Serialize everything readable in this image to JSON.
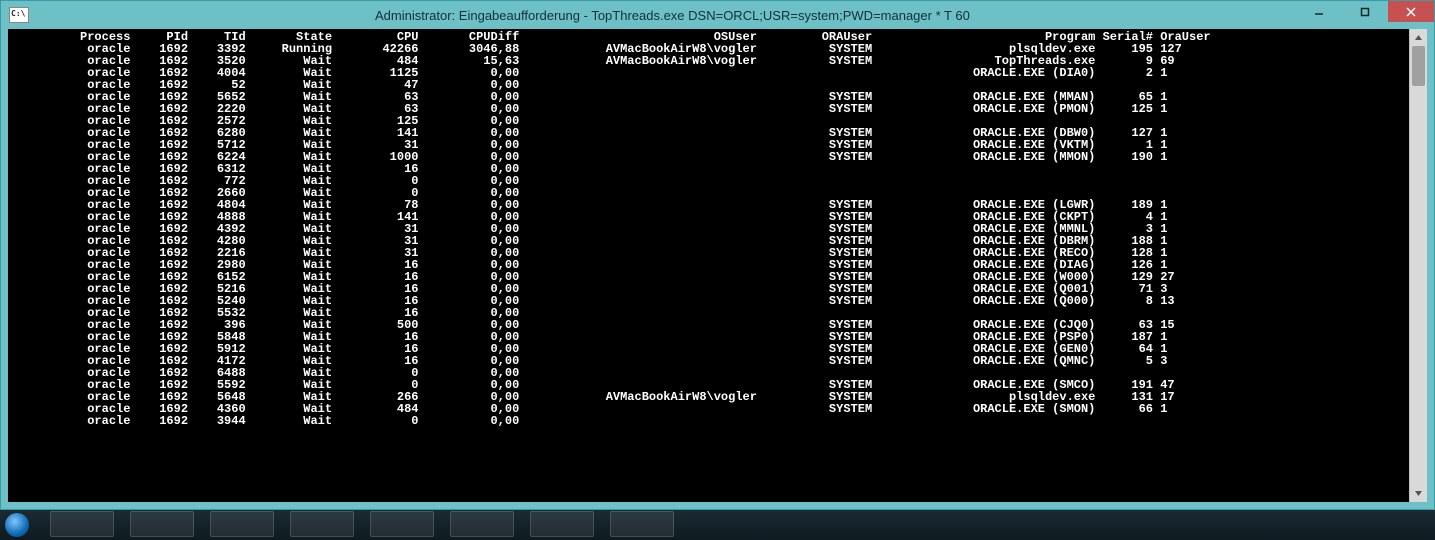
{
  "window": {
    "title": "Administrator: Eingabeaufforderung - TopThreads.exe  DSN=ORCL;USR=system;PWD=manager * T 60"
  },
  "columns": [
    "Process",
    "PId",
    "TId",
    "State",
    "CPU",
    "CPUDiff",
    "OSUser",
    "ORAUser",
    "Program",
    "Serial#",
    "OraUser"
  ],
  "rows": [
    {
      "Process": "oracle",
      "PId": "1692",
      "TId": "3392",
      "State": "Running",
      "CPU": "42266",
      "CPUDiff": "3046,88",
      "OSUser": "AVMacBookAirW8\\vogler",
      "ORAUser": "SYSTEM",
      "Program": "plsqldev.exe",
      "Serial": "195",
      "OraUser": "127"
    },
    {
      "Process": "oracle",
      "PId": "1692",
      "TId": "3520",
      "State": "Wait",
      "CPU": "484",
      "CPUDiff": "15,63",
      "OSUser": "AVMacBookAirW8\\vogler",
      "ORAUser": "SYSTEM",
      "Program": "TopThreads.exe",
      "Serial": "9",
      "OraUser": "69"
    },
    {
      "Process": "oracle",
      "PId": "1692",
      "TId": "4004",
      "State": "Wait",
      "CPU": "1125",
      "CPUDiff": "0,00",
      "OSUser": "",
      "ORAUser": "",
      "Program": "ORACLE.EXE (DIA0)",
      "Serial": "2",
      "OraUser": "1"
    },
    {
      "Process": "oracle",
      "PId": "1692",
      "TId": "52",
      "State": "Wait",
      "CPU": "47",
      "CPUDiff": "0,00",
      "OSUser": "",
      "ORAUser": "",
      "Program": "",
      "Serial": "",
      "OraUser": ""
    },
    {
      "Process": "oracle",
      "PId": "1692",
      "TId": "5652",
      "State": "Wait",
      "CPU": "63",
      "CPUDiff": "0,00",
      "OSUser": "",
      "ORAUser": "SYSTEM",
      "Program": "ORACLE.EXE (MMAN)",
      "Serial": "65",
      "OraUser": "1"
    },
    {
      "Process": "oracle",
      "PId": "1692",
      "TId": "2220",
      "State": "Wait",
      "CPU": "63",
      "CPUDiff": "0,00",
      "OSUser": "",
      "ORAUser": "SYSTEM",
      "Program": "ORACLE.EXE (PMON)",
      "Serial": "125",
      "OraUser": "1"
    },
    {
      "Process": "oracle",
      "PId": "1692",
      "TId": "2572",
      "State": "Wait",
      "CPU": "125",
      "CPUDiff": "0,00",
      "OSUser": "",
      "ORAUser": "",
      "Program": "",
      "Serial": "",
      "OraUser": ""
    },
    {
      "Process": "oracle",
      "PId": "1692",
      "TId": "6280",
      "State": "Wait",
      "CPU": "141",
      "CPUDiff": "0,00",
      "OSUser": "",
      "ORAUser": "SYSTEM",
      "Program": "ORACLE.EXE (DBW0)",
      "Serial": "127",
      "OraUser": "1"
    },
    {
      "Process": "oracle",
      "PId": "1692",
      "TId": "5712",
      "State": "Wait",
      "CPU": "31",
      "CPUDiff": "0,00",
      "OSUser": "",
      "ORAUser": "SYSTEM",
      "Program": "ORACLE.EXE (VKTM)",
      "Serial": "1",
      "OraUser": "1"
    },
    {
      "Process": "oracle",
      "PId": "1692",
      "TId": "6224",
      "State": "Wait",
      "CPU": "1000",
      "CPUDiff": "0,00",
      "OSUser": "",
      "ORAUser": "SYSTEM",
      "Program": "ORACLE.EXE (MMON)",
      "Serial": "190",
      "OraUser": "1"
    },
    {
      "Process": "oracle",
      "PId": "1692",
      "TId": "6312",
      "State": "Wait",
      "CPU": "16",
      "CPUDiff": "0,00",
      "OSUser": "",
      "ORAUser": "",
      "Program": "",
      "Serial": "",
      "OraUser": ""
    },
    {
      "Process": "oracle",
      "PId": "1692",
      "TId": "772",
      "State": "Wait",
      "CPU": "0",
      "CPUDiff": "0,00",
      "OSUser": "",
      "ORAUser": "",
      "Program": "",
      "Serial": "",
      "OraUser": ""
    },
    {
      "Process": "oracle",
      "PId": "1692",
      "TId": "2660",
      "State": "Wait",
      "CPU": "0",
      "CPUDiff": "0,00",
      "OSUser": "",
      "ORAUser": "",
      "Program": "",
      "Serial": "",
      "OraUser": ""
    },
    {
      "Process": "oracle",
      "PId": "1692",
      "TId": "4804",
      "State": "Wait",
      "CPU": "78",
      "CPUDiff": "0,00",
      "OSUser": "",
      "ORAUser": "SYSTEM",
      "Program": "ORACLE.EXE (LGWR)",
      "Serial": "189",
      "OraUser": "1"
    },
    {
      "Process": "oracle",
      "PId": "1692",
      "TId": "4888",
      "State": "Wait",
      "CPU": "141",
      "CPUDiff": "0,00",
      "OSUser": "",
      "ORAUser": "SYSTEM",
      "Program": "ORACLE.EXE (CKPT)",
      "Serial": "4",
      "OraUser": "1"
    },
    {
      "Process": "oracle",
      "PId": "1692",
      "TId": "4392",
      "State": "Wait",
      "CPU": "31",
      "CPUDiff": "0,00",
      "OSUser": "",
      "ORAUser": "SYSTEM",
      "Program": "ORACLE.EXE (MMNL)",
      "Serial": "3",
      "OraUser": "1"
    },
    {
      "Process": "oracle",
      "PId": "1692",
      "TId": "4280",
      "State": "Wait",
      "CPU": "31",
      "CPUDiff": "0,00",
      "OSUser": "",
      "ORAUser": "SYSTEM",
      "Program": "ORACLE.EXE (DBRM)",
      "Serial": "188",
      "OraUser": "1"
    },
    {
      "Process": "oracle",
      "PId": "1692",
      "TId": "2216",
      "State": "Wait",
      "CPU": "31",
      "CPUDiff": "0,00",
      "OSUser": "",
      "ORAUser": "SYSTEM",
      "Program": "ORACLE.EXE (RECO)",
      "Serial": "128",
      "OraUser": "1"
    },
    {
      "Process": "oracle",
      "PId": "1692",
      "TId": "2980",
      "State": "Wait",
      "CPU": "16",
      "CPUDiff": "0,00",
      "OSUser": "",
      "ORAUser": "SYSTEM",
      "Program": "ORACLE.EXE (DIAG)",
      "Serial": "126",
      "OraUser": "1"
    },
    {
      "Process": "oracle",
      "PId": "1692",
      "TId": "6152",
      "State": "Wait",
      "CPU": "16",
      "CPUDiff": "0,00",
      "OSUser": "",
      "ORAUser": "SYSTEM",
      "Program": "ORACLE.EXE (W000)",
      "Serial": "129",
      "OraUser": "27"
    },
    {
      "Process": "oracle",
      "PId": "1692",
      "TId": "5216",
      "State": "Wait",
      "CPU": "16",
      "CPUDiff": "0,00",
      "OSUser": "",
      "ORAUser": "SYSTEM",
      "Program": "ORACLE.EXE (Q001)",
      "Serial": "71",
      "OraUser": "3"
    },
    {
      "Process": "oracle",
      "PId": "1692",
      "TId": "5240",
      "State": "Wait",
      "CPU": "16",
      "CPUDiff": "0,00",
      "OSUser": "",
      "ORAUser": "SYSTEM",
      "Program": "ORACLE.EXE (Q000)",
      "Serial": "8",
      "OraUser": "13"
    },
    {
      "Process": "oracle",
      "PId": "1692",
      "TId": "5532",
      "State": "Wait",
      "CPU": "16",
      "CPUDiff": "0,00",
      "OSUser": "",
      "ORAUser": "",
      "Program": "",
      "Serial": "",
      "OraUser": ""
    },
    {
      "Process": "oracle",
      "PId": "1692",
      "TId": "396",
      "State": "Wait",
      "CPU": "500",
      "CPUDiff": "0,00",
      "OSUser": "",
      "ORAUser": "SYSTEM",
      "Program": "ORACLE.EXE (CJQ0)",
      "Serial": "63",
      "OraUser": "15"
    },
    {
      "Process": "oracle",
      "PId": "1692",
      "TId": "5848",
      "State": "Wait",
      "CPU": "16",
      "CPUDiff": "0,00",
      "OSUser": "",
      "ORAUser": "SYSTEM",
      "Program": "ORACLE.EXE (PSP0)",
      "Serial": "187",
      "OraUser": "1"
    },
    {
      "Process": "oracle",
      "PId": "1692",
      "TId": "5912",
      "State": "Wait",
      "CPU": "16",
      "CPUDiff": "0,00",
      "OSUser": "",
      "ORAUser": "SYSTEM",
      "Program": "ORACLE.EXE (GEN0)",
      "Serial": "64",
      "OraUser": "1"
    },
    {
      "Process": "oracle",
      "PId": "1692",
      "TId": "4172",
      "State": "Wait",
      "CPU": "16",
      "CPUDiff": "0,00",
      "OSUser": "",
      "ORAUser": "SYSTEM",
      "Program": "ORACLE.EXE (QMNC)",
      "Serial": "5",
      "OraUser": "3"
    },
    {
      "Process": "oracle",
      "PId": "1692",
      "TId": "6488",
      "State": "Wait",
      "CPU": "0",
      "CPUDiff": "0,00",
      "OSUser": "",
      "ORAUser": "",
      "Program": "",
      "Serial": "",
      "OraUser": ""
    },
    {
      "Process": "oracle",
      "PId": "1692",
      "TId": "5592",
      "State": "Wait",
      "CPU": "0",
      "CPUDiff": "0,00",
      "OSUser": "",
      "ORAUser": "SYSTEM",
      "Program": "ORACLE.EXE (SMCO)",
      "Serial": "191",
      "OraUser": "47"
    },
    {
      "Process": "oracle",
      "PId": "1692",
      "TId": "5648",
      "State": "Wait",
      "CPU": "266",
      "CPUDiff": "0,00",
      "OSUser": "AVMacBookAirW8\\vogler",
      "ORAUser": "SYSTEM",
      "Program": "plsqldev.exe",
      "Serial": "131",
      "OraUser": "17"
    },
    {
      "Process": "oracle",
      "PId": "1692",
      "TId": "4360",
      "State": "Wait",
      "CPU": "484",
      "CPUDiff": "0,00",
      "OSUser": "",
      "ORAUser": "SYSTEM",
      "Program": "ORACLE.EXE (SMON)",
      "Serial": "66",
      "OraUser": "1"
    },
    {
      "Process": "oracle",
      "PId": "1692",
      "TId": "3944",
      "State": "Wait",
      "CPU": "0",
      "CPUDiff": "0,00",
      "OSUser": "",
      "ORAUser": "",
      "Program": "",
      "Serial": "",
      "OraUser": ""
    }
  ]
}
